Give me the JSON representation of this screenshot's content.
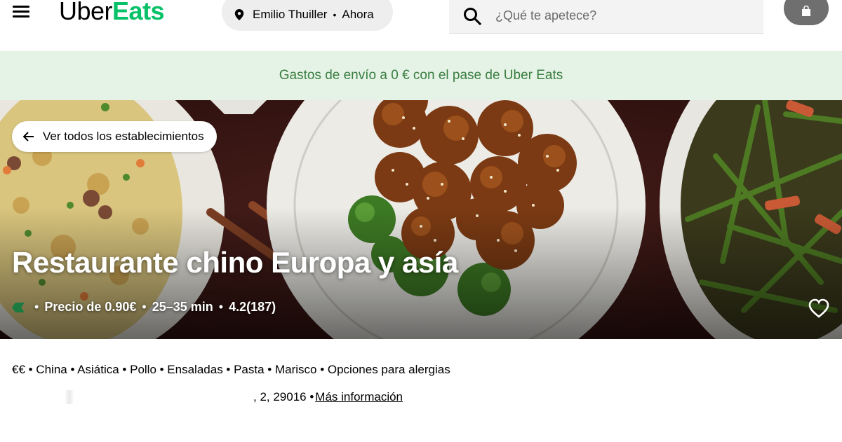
{
  "header": {
    "logo": {
      "uber": "Uber",
      "eats": "Eats"
    },
    "location": {
      "place": "Emilio Thuiller",
      "separator": "•",
      "time": "Ahora"
    },
    "search": {
      "placeholder": "¿Qué te apetece?",
      "value": ""
    },
    "icons": {
      "menu": "hamburger-menu-icon",
      "pin": "location-pin-icon",
      "search": "search-icon",
      "cart": "shopping-bag-icon"
    }
  },
  "promo": {
    "text": "Gastos de envío a 0 € con el pase de Uber Eats"
  },
  "hero": {
    "back_label": "Ver todos los establecimientos",
    "title": "Restaurante chino Europa y asía",
    "meta": {
      "delivery_fee": "Precio de 0.90€",
      "time": "25–35 min",
      "rating": "4.2",
      "reviews": "(187)",
      "separator": "•"
    },
    "icons": {
      "back": "arrow-left-icon",
      "pass": "uber-one-pass-icon",
      "favorite": "heart-icon"
    }
  },
  "info": {
    "tags": "€€ • China • Asiática • Pollo • Ensaladas • Pasta • Marisco • Opciones para alergias",
    "address_visible": ", 2, 29016 •",
    "more_info": "Más información"
  },
  "colors": {
    "brand_green": "#06c167",
    "promo_bg": "#e5f3e6",
    "promo_text": "#3a7d41"
  }
}
